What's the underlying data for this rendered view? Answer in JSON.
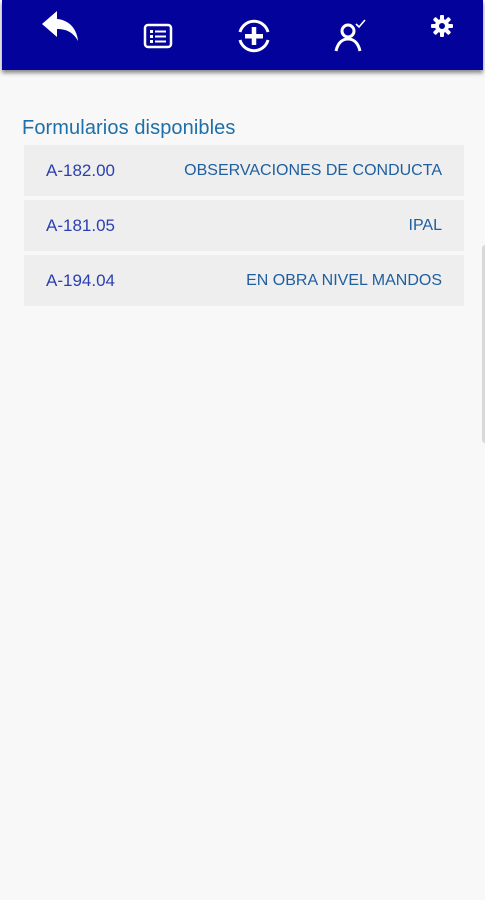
{
  "toolbar": {
    "background": "#03039b",
    "buttons": [
      {
        "icon": "reply-arrow-icon"
      },
      {
        "icon": "form-list-icon"
      },
      {
        "icon": "add-circle-icon"
      },
      {
        "icon": "person-check-icon"
      },
      {
        "icon": "gear-icon"
      }
    ]
  },
  "main": {
    "section_title": "Formularios disponibles",
    "forms": [
      {
        "code": "A-182.00",
        "name": "OBSERVACIONES DE CONDUCTA"
      },
      {
        "code": "A-181.05",
        "name": "IPAL"
      },
      {
        "code": "A-194.04",
        "name": "EN OBRA NIVEL MANDOS"
      }
    ]
  }
}
